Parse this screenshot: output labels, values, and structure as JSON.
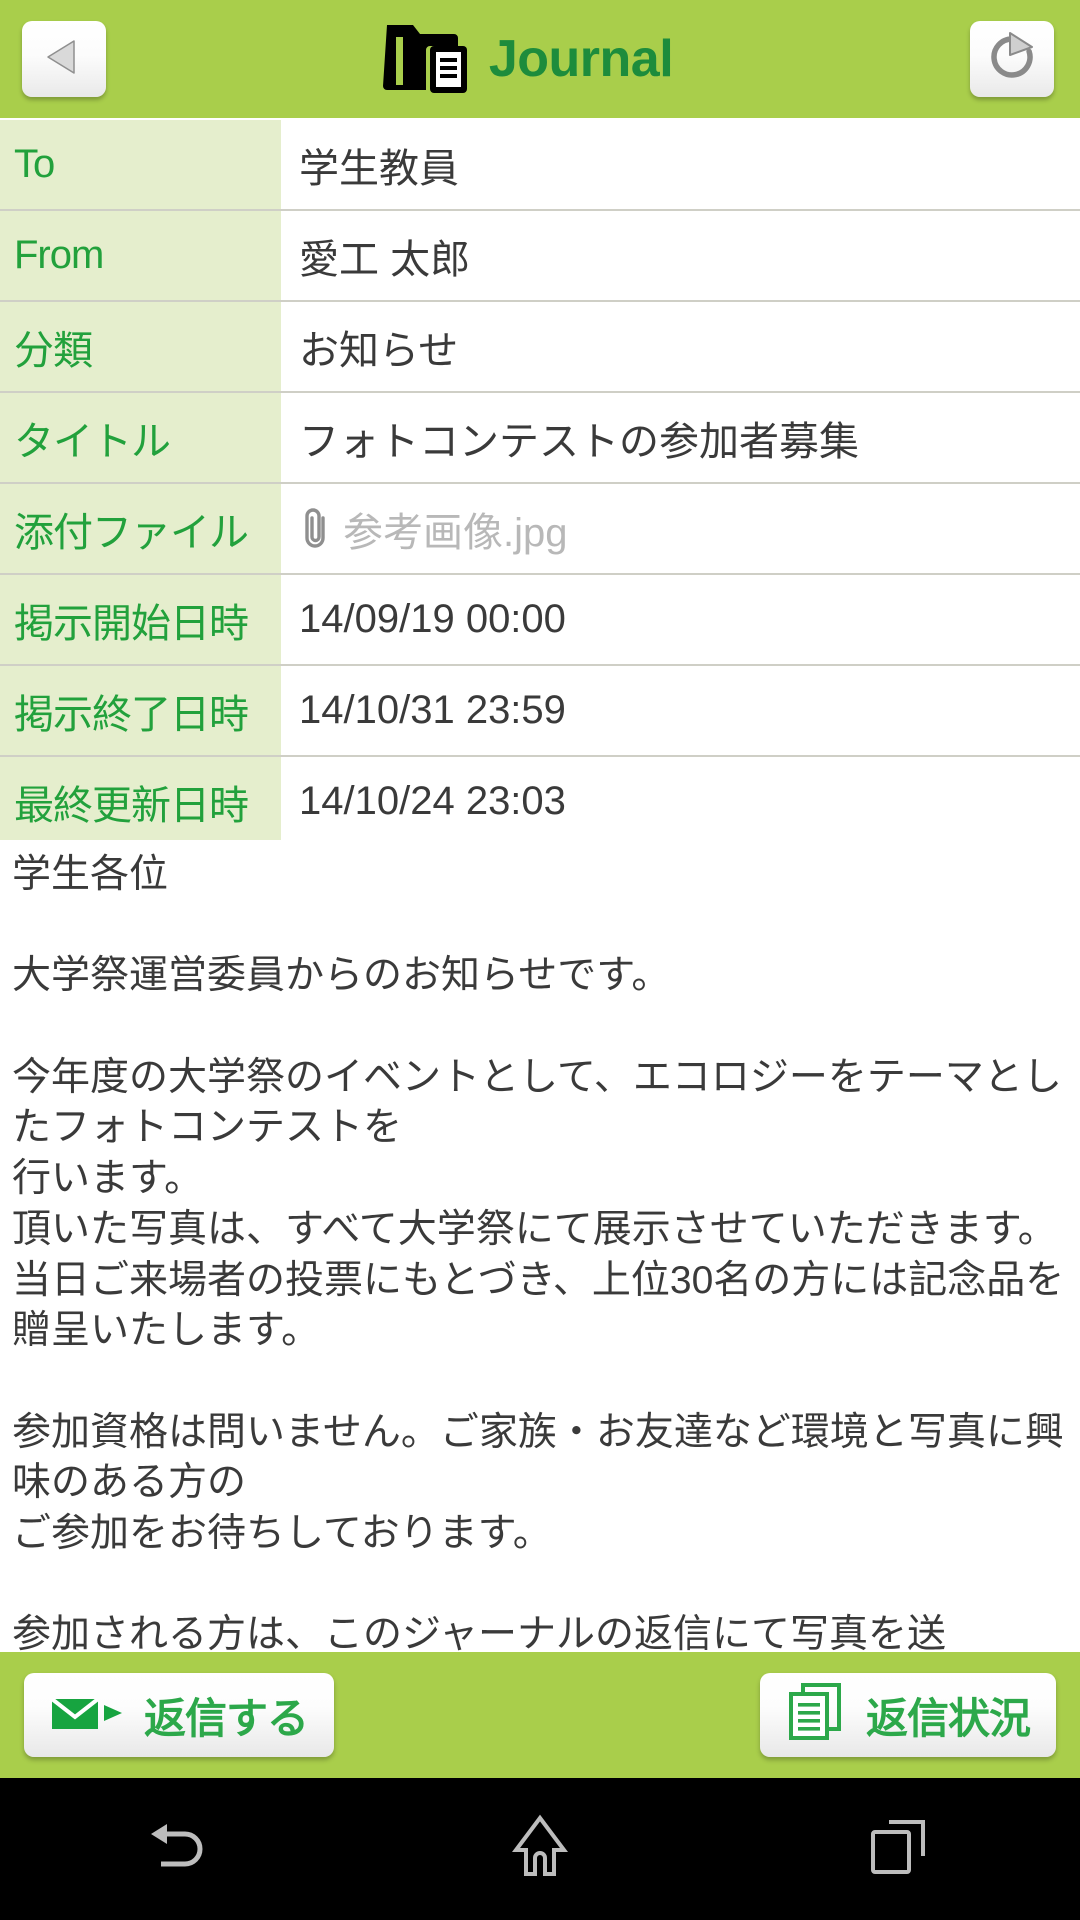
{
  "header": {
    "title": "Journal",
    "back_icon": "back-triangle-icon",
    "refresh_icon": "refresh-icon",
    "app_icon": "journal-folder-icon",
    "bg_color": "#a9ce4b",
    "title_color": "#1d8c3c"
  },
  "detail": {
    "rows": [
      {
        "label": "To",
        "value": "学生教員",
        "type": "text"
      },
      {
        "label": "From",
        "value": "愛工 太郎",
        "type": "text"
      },
      {
        "label": "分類",
        "value": "お知らせ",
        "type": "text"
      },
      {
        "label": "タイトル",
        "value": "フォトコンテストの参加者募集",
        "type": "text"
      },
      {
        "label": "添付ファイル",
        "value": "参考画像.jpg",
        "type": "attachment"
      },
      {
        "label": "掲示開始日時",
        "value": "14/09/19 00:00",
        "type": "text"
      },
      {
        "label": "掲示終了日時",
        "value": "14/10/31 23:59",
        "type": "text"
      },
      {
        "label": "最終更新日時",
        "value": "14/10/24 23:03",
        "type": "text"
      }
    ],
    "label_bg_color": "#e5eecd",
    "label_text_color": "#22a13c"
  },
  "body": {
    "text": "学生各位\n\n大学祭運営委員からのお知らせです。\n\n今年度の大学祭のイベントとして、エコロジーをテーマとしたフォトコンテストを\n行います。\n頂いた写真は、すべて大学祭にて展示させていただきます。\n当日ご来場者の投票にもとづき、上位30名の方には記念品を贈呈いたします。\n\n参加資格は問いません。ご家族・お友達など環境と写真に興味のある方の\nご参加をお待ちしております。\n\n参加される方は、このジャーナルの返信にて写真を送"
  },
  "actions": {
    "reply": {
      "label": "返信する",
      "icon": "mail-forward-icon"
    },
    "reply_status": {
      "label": "返信状況",
      "icon": "document-stack-icon"
    },
    "accent_color": "#2ca84a"
  },
  "nav": {
    "back": "android-back-icon",
    "home": "android-home-icon",
    "recents": "android-recents-icon"
  }
}
